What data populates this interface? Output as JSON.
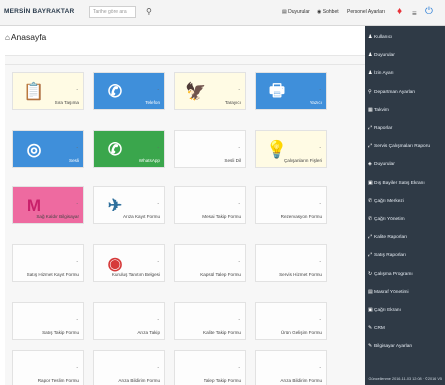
{
  "header": {
    "brand": "MERSİN BAYRAKTAR",
    "search_placeholder": "Tarihe göre ara",
    "nav": [
      {
        "label": "Duyurular"
      },
      {
        "label": "Sohbet"
      },
      {
        "label": "Personel Ayarları"
      }
    ],
    "colors": {
      "flame": "#e8343b",
      "power": "#2d7fd6"
    }
  },
  "page": {
    "title": "Anasayfa"
  },
  "tiles": [
    {
      "label": "Sıra Taşıma",
      "icon": "document-icon",
      "bg": "#fffbe4",
      "icon_color": "#555555",
      "glyph": "📋"
    },
    {
      "label": "Telefon",
      "icon": "phone-icon",
      "bg": "#3f8fda",
      "icon_color": "#ffffff",
      "glyph": "✆"
    },
    {
      "label": "Tarayıcı",
      "icon": "eagle-icon",
      "bg": "#fffbe4",
      "icon_color": "#6b4a2b",
      "glyph": "🦅"
    },
    {
      "label": "Yazıcı",
      "icon": "printer-icon",
      "bg": "#3f8fda",
      "icon_color": "#ffffff",
      "glyph": "🖶"
    },
    {
      "label": "Sesli",
      "icon": "sound-icon",
      "bg": "#3f8fda",
      "icon_color": "#ffffff",
      "glyph": "◎"
    },
    {
      "label": "WhatsApp",
      "icon": "whatsapp-icon",
      "bg": "#3aa64c",
      "icon_color": "#ffffff",
      "glyph": "✆"
    },
    {
      "label": "Sesli Dil",
      "icon": "",
      "bg": "#fdfdfd",
      "icon_color": "#999999",
      "glyph": ""
    },
    {
      "label": "Çalışanların Fişleri",
      "icon": "bulb-icon",
      "bg": "#fffbe4",
      "icon_color": "#f4c21a",
      "glyph": "💡"
    },
    {
      "label": "Sağ Kaldır Bilgisayar",
      "icon": "m-logo-icon",
      "bg": "#ee6aa0",
      "icon_color": "#c9206b",
      "glyph": "M"
    },
    {
      "label": "Arıza Kayıt Formu",
      "icon": "drone-icon",
      "bg": "#fdfdfd",
      "icon_color": "#2e6f9c",
      "glyph": "✈"
    },
    {
      "label": "Mesai Takip Formu",
      "icon": "",
      "bg": "#fdfdfd",
      "icon_color": "#999999",
      "glyph": ""
    },
    {
      "label": "Rezervasyon Formu",
      "icon": "",
      "bg": "#fdfdfd",
      "icon_color": "#999999",
      "glyph": ""
    },
    {
      "label": "Satış Hizmet Kayıt Formu",
      "icon": "",
      "bg": "#fdfdfd",
      "icon_color": "#999999",
      "glyph": ""
    },
    {
      "label": "Kuruluş Tanıtım Belgesi",
      "icon": "seal-icon",
      "bg": "#fdfdfd",
      "icon_color": "#d63a3a",
      "glyph": "◉"
    },
    {
      "label": "Kapsül Talep Formu",
      "icon": "",
      "bg": "#fdfdfd",
      "icon_color": "#999999",
      "glyph": ""
    },
    {
      "label": "Servis Hizmet Formu",
      "icon": "",
      "bg": "#fdfdfd",
      "icon_color": "#999999",
      "glyph": ""
    },
    {
      "label": "Satış Takip Formu",
      "icon": "",
      "bg": "#fdfdfd",
      "icon_color": "#999999",
      "glyph": ""
    },
    {
      "label": "Arıza Takip",
      "icon": "",
      "bg": "#fdfdfd",
      "icon_color": "#999999",
      "glyph": ""
    },
    {
      "label": "Kalite Takip Formu",
      "icon": "",
      "bg": "#fdfdfd",
      "icon_color": "#999999",
      "glyph": ""
    },
    {
      "label": "Ürün Gelişim Formu",
      "icon": "",
      "bg": "#fdfdfd",
      "icon_color": "#999999",
      "glyph": ""
    },
    {
      "label": "Rapor Teslim Formu",
      "icon": "",
      "bg": "#fdfdfd",
      "icon_color": "#999999",
      "glyph": ""
    },
    {
      "label": "Arıza Bildirim Formu",
      "icon": "",
      "bg": "#fdfdfd",
      "icon_color": "#999999",
      "glyph": ""
    },
    {
      "label": "Talep Takip Formu",
      "icon": "",
      "bg": "#fdfdfd",
      "icon_color": "#999999",
      "glyph": ""
    },
    {
      "label": "Arıza Bildirim Formu",
      "icon": "",
      "bg": "#fdfdfd",
      "icon_color": "#999999",
      "glyph": ""
    }
  ],
  "sidebar": {
    "items": [
      {
        "label": "Kullanıcı",
        "icon": "user-icon",
        "glyph": "♟"
      },
      {
        "label": "Duyurular",
        "icon": "user-icon",
        "glyph": "♟"
      },
      {
        "label": "İzin Ayarı",
        "icon": "users-icon",
        "glyph": "♟"
      },
      {
        "label": "Departman Ayarları",
        "icon": "sitemap-icon",
        "glyph": "⚲"
      },
      {
        "label": "Takvim",
        "icon": "calendar-icon",
        "glyph": "▦"
      },
      {
        "label": "Raporlar",
        "icon": "chart-icon",
        "glyph": "⤢"
      },
      {
        "label": "Servis Çalışmaları Raporu",
        "icon": "chart-icon",
        "glyph": "⤢"
      },
      {
        "label": "Duyurular",
        "icon": "bell-icon",
        "glyph": "◈"
      },
      {
        "label": "Dış Bayiler Satış Ekranı",
        "icon": "store-icon",
        "glyph": "▣"
      },
      {
        "label": "Çağrı Merkezi",
        "icon": "phone-icon",
        "glyph": "✆"
      },
      {
        "label": "Çağrı Yönetim",
        "icon": "phone-icon",
        "glyph": "✆"
      },
      {
        "label": "Kalite Raporları",
        "icon": "chart-icon",
        "glyph": "⤢"
      },
      {
        "label": "Satış Raporları",
        "icon": "chart-icon",
        "glyph": "⤢"
      },
      {
        "label": "Çalışma Programı",
        "icon": "refresh-icon",
        "glyph": "↻"
      },
      {
        "label": "Masraf Yönetimi",
        "icon": "file-icon",
        "glyph": "▤"
      },
      {
        "label": "Çağrı Ekranı",
        "icon": "screen-icon",
        "glyph": "▣"
      },
      {
        "label": "CRM",
        "icon": "tag-icon",
        "glyph": "✎"
      },
      {
        "label": "Bilgisayar Ayarları",
        "icon": "wrench-icon",
        "glyph": "✎"
      }
    ],
    "version": "Güncellenme 2016-11-03 12:08 · ©2016 V5"
  }
}
